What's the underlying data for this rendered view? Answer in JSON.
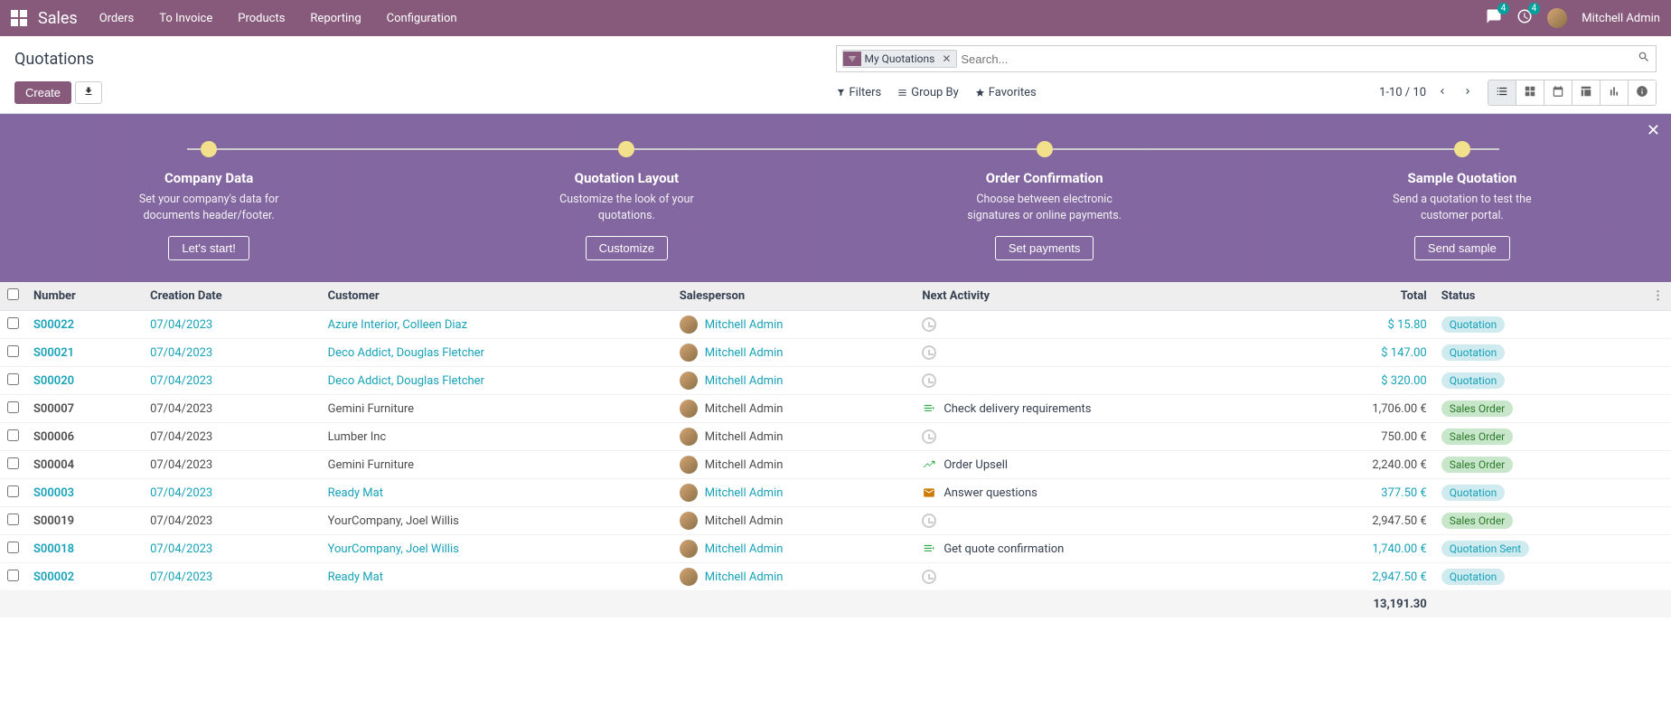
{
  "navbar": {
    "brand": "Sales",
    "menu": [
      "Orders",
      "To Invoice",
      "Products",
      "Reporting",
      "Configuration"
    ],
    "chat_badge": "4",
    "activity_badge": "4",
    "user": "Mitchell Admin"
  },
  "control": {
    "title": "Quotations",
    "facet": "My Quotations",
    "search_placeholder": "Search...",
    "create": "Create",
    "filters": "Filters",
    "groupby": "Group By",
    "favorites": "Favorites",
    "pager": "1-10 / 10"
  },
  "onboarding": {
    "steps": [
      {
        "title": "Company Data",
        "desc": "Set your company's data for documents header/footer.",
        "action": "Let's start!"
      },
      {
        "title": "Quotation Layout",
        "desc": "Customize the look of your quotations.",
        "action": "Customize"
      },
      {
        "title": "Order Confirmation",
        "desc": "Choose between electronic signatures or online payments.",
        "action": "Set payments"
      },
      {
        "title": "Sample Quotation",
        "desc": "Send a quotation to test the customer portal.",
        "action": "Send sample"
      }
    ]
  },
  "table": {
    "headers": {
      "number": "Number",
      "creation": "Creation Date",
      "customer": "Customer",
      "salesperson": "Salesperson",
      "activity": "Next Activity",
      "total": "Total",
      "status": "Status"
    },
    "rows": [
      {
        "link": true,
        "number": "S00022",
        "date": "07/04/2023",
        "customer": "Azure Interior, Colleen Diaz",
        "salesperson": "Mitchell Admin",
        "activity": "",
        "activity_type": "clock",
        "total": "$ 15.80",
        "status": "Quotation",
        "status_class": "quotation"
      },
      {
        "link": true,
        "number": "S00021",
        "date": "07/04/2023",
        "customer": "Deco Addict, Douglas Fletcher",
        "salesperson": "Mitchell Admin",
        "activity": "",
        "activity_type": "clock",
        "total": "$ 147.00",
        "status": "Quotation",
        "status_class": "quotation"
      },
      {
        "link": true,
        "number": "S00020",
        "date": "07/04/2023",
        "customer": "Deco Addict, Douglas Fletcher",
        "salesperson": "Mitchell Admin",
        "activity": "",
        "activity_type": "clock",
        "total": "$ 320.00",
        "status": "Quotation",
        "status_class": "quotation"
      },
      {
        "link": false,
        "number": "S00007",
        "date": "07/04/2023",
        "customer": "Gemini Furniture",
        "salesperson": "Mitchell Admin",
        "activity": "Check delivery requirements",
        "activity_type": "task-green",
        "total": "1,706.00 €",
        "status": "Sales Order",
        "status_class": "salesorder"
      },
      {
        "link": false,
        "number": "S00006",
        "date": "07/04/2023",
        "customer": "Lumber Inc",
        "salesperson": "Mitchell Admin",
        "activity": "",
        "activity_type": "clock",
        "total": "750.00 €",
        "status": "Sales Order",
        "status_class": "salesorder"
      },
      {
        "link": false,
        "number": "S00004",
        "date": "07/04/2023",
        "customer": "Gemini Furniture",
        "salesperson": "Mitchell Admin",
        "activity": "Order Upsell",
        "activity_type": "chart-green",
        "total": "2,240.00 €",
        "status": "Sales Order",
        "status_class": "salesorder"
      },
      {
        "link": true,
        "number": "S00003",
        "date": "07/04/2023",
        "customer": "Ready Mat",
        "salesperson": "Mitchell Admin",
        "activity": "Answer questions",
        "activity_type": "mail-orange",
        "total": "377.50 €",
        "status": "Quotation",
        "status_class": "quotation"
      },
      {
        "link": false,
        "number": "S00019",
        "date": "07/04/2023",
        "customer": "YourCompany, Joel Willis",
        "salesperson": "Mitchell Admin",
        "activity": "",
        "activity_type": "clock",
        "total": "2,947.50 €",
        "status": "Sales Order",
        "status_class": "salesorder"
      },
      {
        "link": true,
        "number": "S00018",
        "date": "07/04/2023",
        "customer": "YourCompany, Joel Willis",
        "salesperson": "Mitchell Admin",
        "activity": "Get quote confirmation",
        "activity_type": "task-green",
        "total": "1,740.00 €",
        "status": "Quotation Sent",
        "status_class": "quotationsent"
      },
      {
        "link": true,
        "number": "S00002",
        "date": "07/04/2023",
        "customer": "Ready Mat",
        "salesperson": "Mitchell Admin",
        "activity": "",
        "activity_type": "clock",
        "total": "2,947.50 €",
        "status": "Quotation",
        "status_class": "quotation"
      }
    ],
    "footer_total": "13,191.30"
  }
}
